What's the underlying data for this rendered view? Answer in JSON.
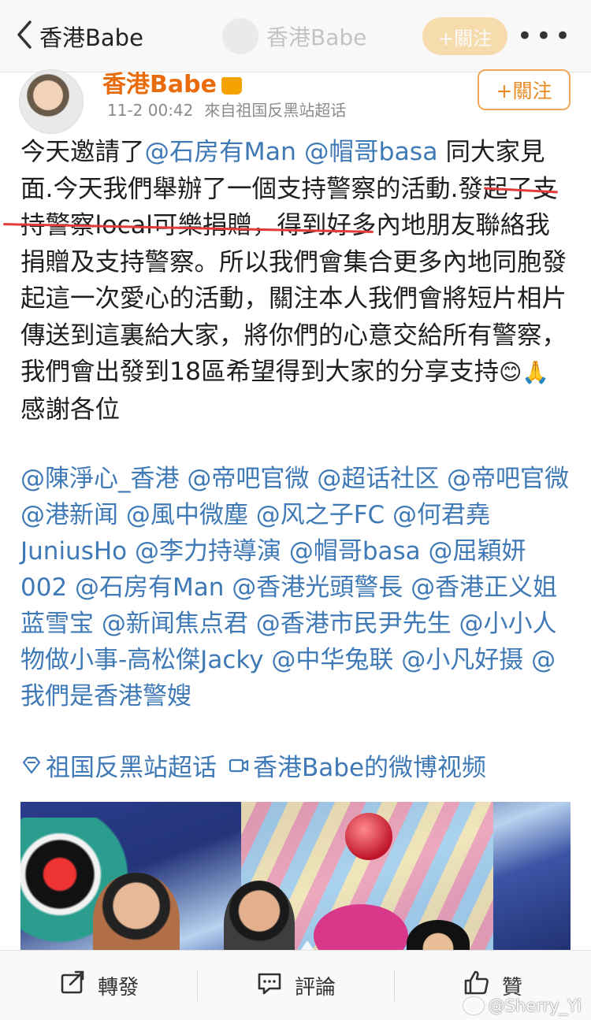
{
  "navbar": {
    "back_title": "香港Babe",
    "center_name": "香港Babe",
    "follow_label": "+關注",
    "more_label": "•••"
  },
  "author": {
    "name": "香港Babe",
    "time": "11-2 00:42",
    "source": "來自祖国反黑站超话",
    "follow_label": "+關注"
  },
  "post": {
    "line_parts": {
      "p1": "今天邀請了",
      "m1": "@石房有Man",
      "m2": "@帽哥basa",
      "p2": " 同大家見面.今天我們舉辦了一個支持警察的活動.發起了支持警察local可樂捐贈，得到好多內地朋友聯絡我捐贈及支持警察。所以我們會集合更多內地同胞發起這一次愛心的活動，關注本人我們會將短片相片傳送到這裏給大家，將你們的心意交給所有警察，我們會出發到18區希望得到大家的分享支持",
      "emoji": "😊🙏",
      "p3": "感謝各位"
    },
    "mentions": "@陳淨心_香港 @帝吧官微 @超话社区 @帝吧官微 @港新闻 @風中微塵 @风之子FC @何君堯JuniusHo @李力持導演 @帽哥basa @屈穎妍002 @石房有Man @香港光頭警長 @香港正义姐蓝雪宝 @新闻焦点君 @香港市民尹先生 @小小人物做小事-高松傑Jacky @中华兔联 @小凡好摄 @我們是香港警嫂",
    "topics": [
      {
        "icon": "diamond-topic-icon",
        "label": "祖国反黑站超话"
      },
      {
        "icon": "video-topic-icon",
        "label": "香港Babe的微博视频"
      }
    ]
  },
  "actions": {
    "repost": "轉發",
    "comment": "評論",
    "like": "贊"
  },
  "watermark": "@Sherry_Yi",
  "colors": {
    "link": "#3f79b6",
    "author_name": "#e86b0c",
    "underline": "#e33a3a",
    "follow_border": "#f0a85a"
  }
}
